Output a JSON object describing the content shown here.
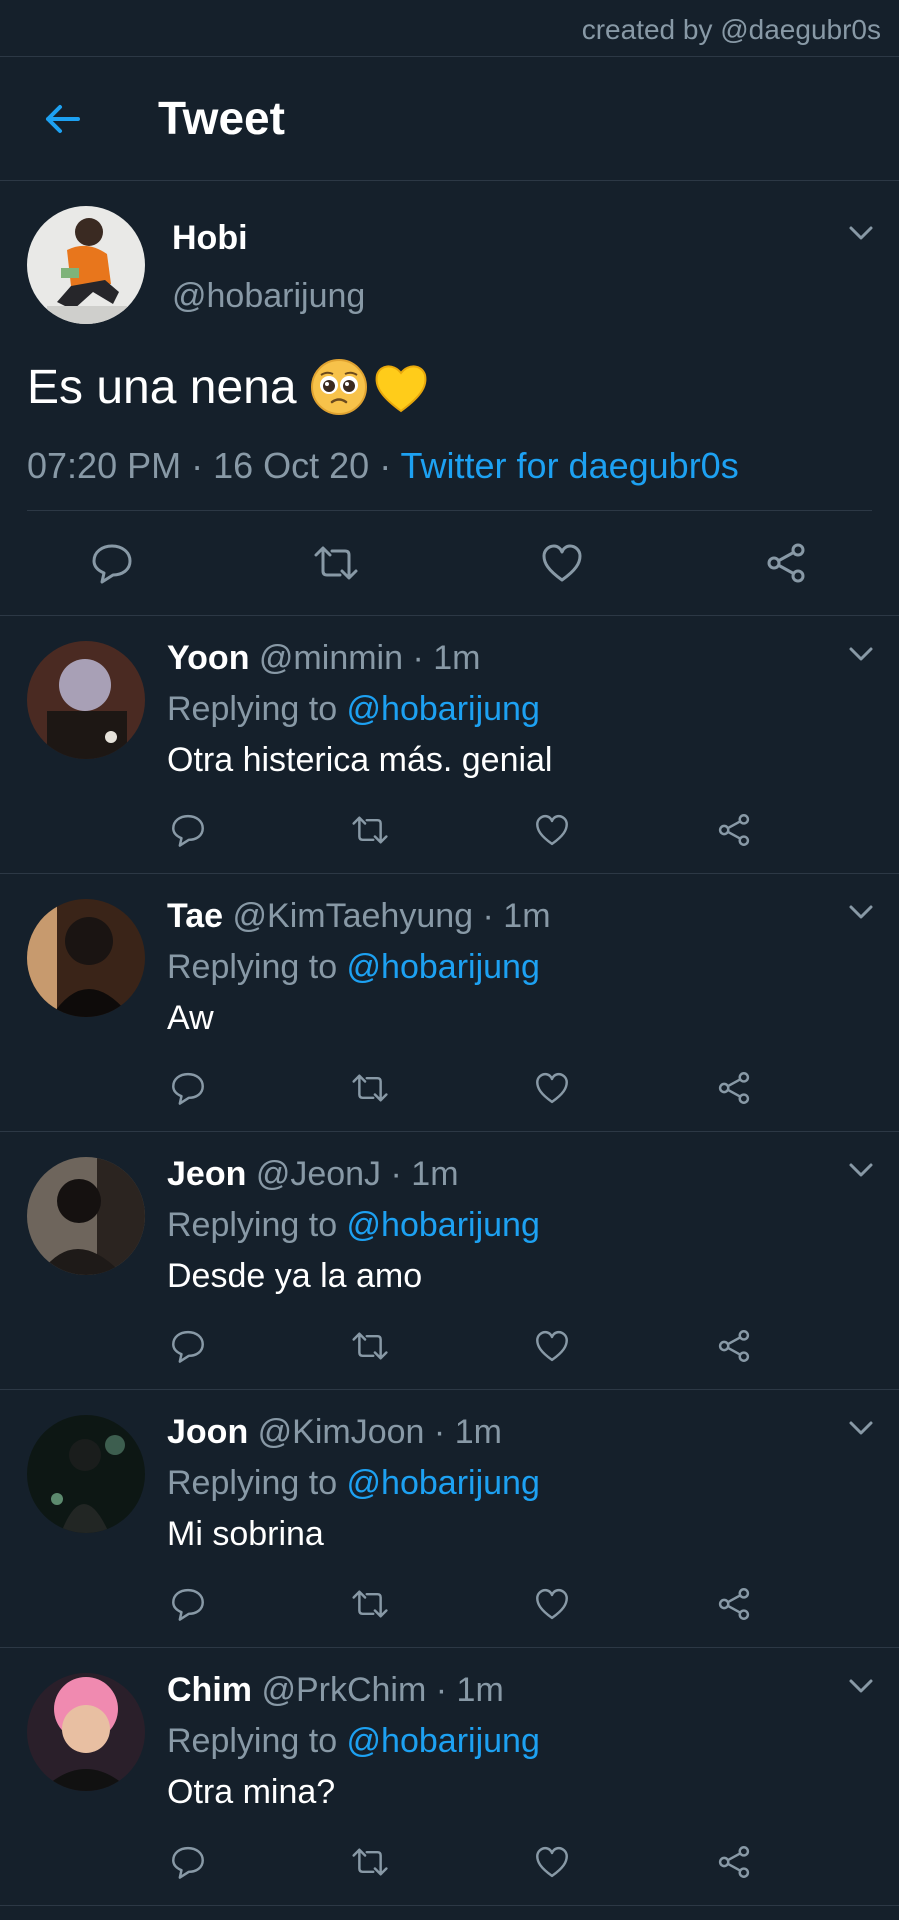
{
  "watermark": "created by @daegubr0s",
  "header": {
    "title": "Tweet",
    "back_icon": "back-arrow-icon"
  },
  "colors": {
    "background": "#15202b",
    "accent": "#1da1f2",
    "secondary_text": "#8899a6",
    "divider": "#2c3845"
  },
  "main_tweet": {
    "name": "Hobi",
    "handle": "@hobarijung",
    "text": "Es una nena",
    "emojis": [
      "pleading-face",
      "yellow-heart"
    ],
    "time": "07:20 PM",
    "sep1": " · ",
    "date": "16 Oct 20",
    "sep2": " · ",
    "source": "Twitter for daegubr0s",
    "actions": [
      "reply-icon",
      "retweet-icon",
      "like-icon",
      "share-icon"
    ]
  },
  "replies": [
    {
      "name": "Yoon",
      "handle": "@minmin",
      "time": "1m",
      "replying_prefix": "Replying to ",
      "replying_to": "@hobarijung",
      "text": "Otra histerica más. genial"
    },
    {
      "name": "Tae",
      "handle": "@KimTaehyung",
      "time": "1m",
      "replying_prefix": "Replying to ",
      "replying_to": "@hobarijung",
      "text": "Aw"
    },
    {
      "name": "Jeon",
      "handle": "@JeonJ",
      "time": "1m",
      "replying_prefix": "Replying to ",
      "replying_to": "@hobarijung",
      "text": "Desde ya la amo"
    },
    {
      "name": "Joon",
      "handle": "@KimJoon",
      "time": "1m",
      "replying_prefix": "Replying to ",
      "replying_to": "@hobarijung",
      "text": "Mi sobrina"
    },
    {
      "name": "Chim",
      "handle": "@PrkChim",
      "time": "1m",
      "replying_prefix": "Replying to ",
      "replying_to": "@hobarijung",
      "text": "Otra mina?"
    }
  ],
  "sep": " · "
}
